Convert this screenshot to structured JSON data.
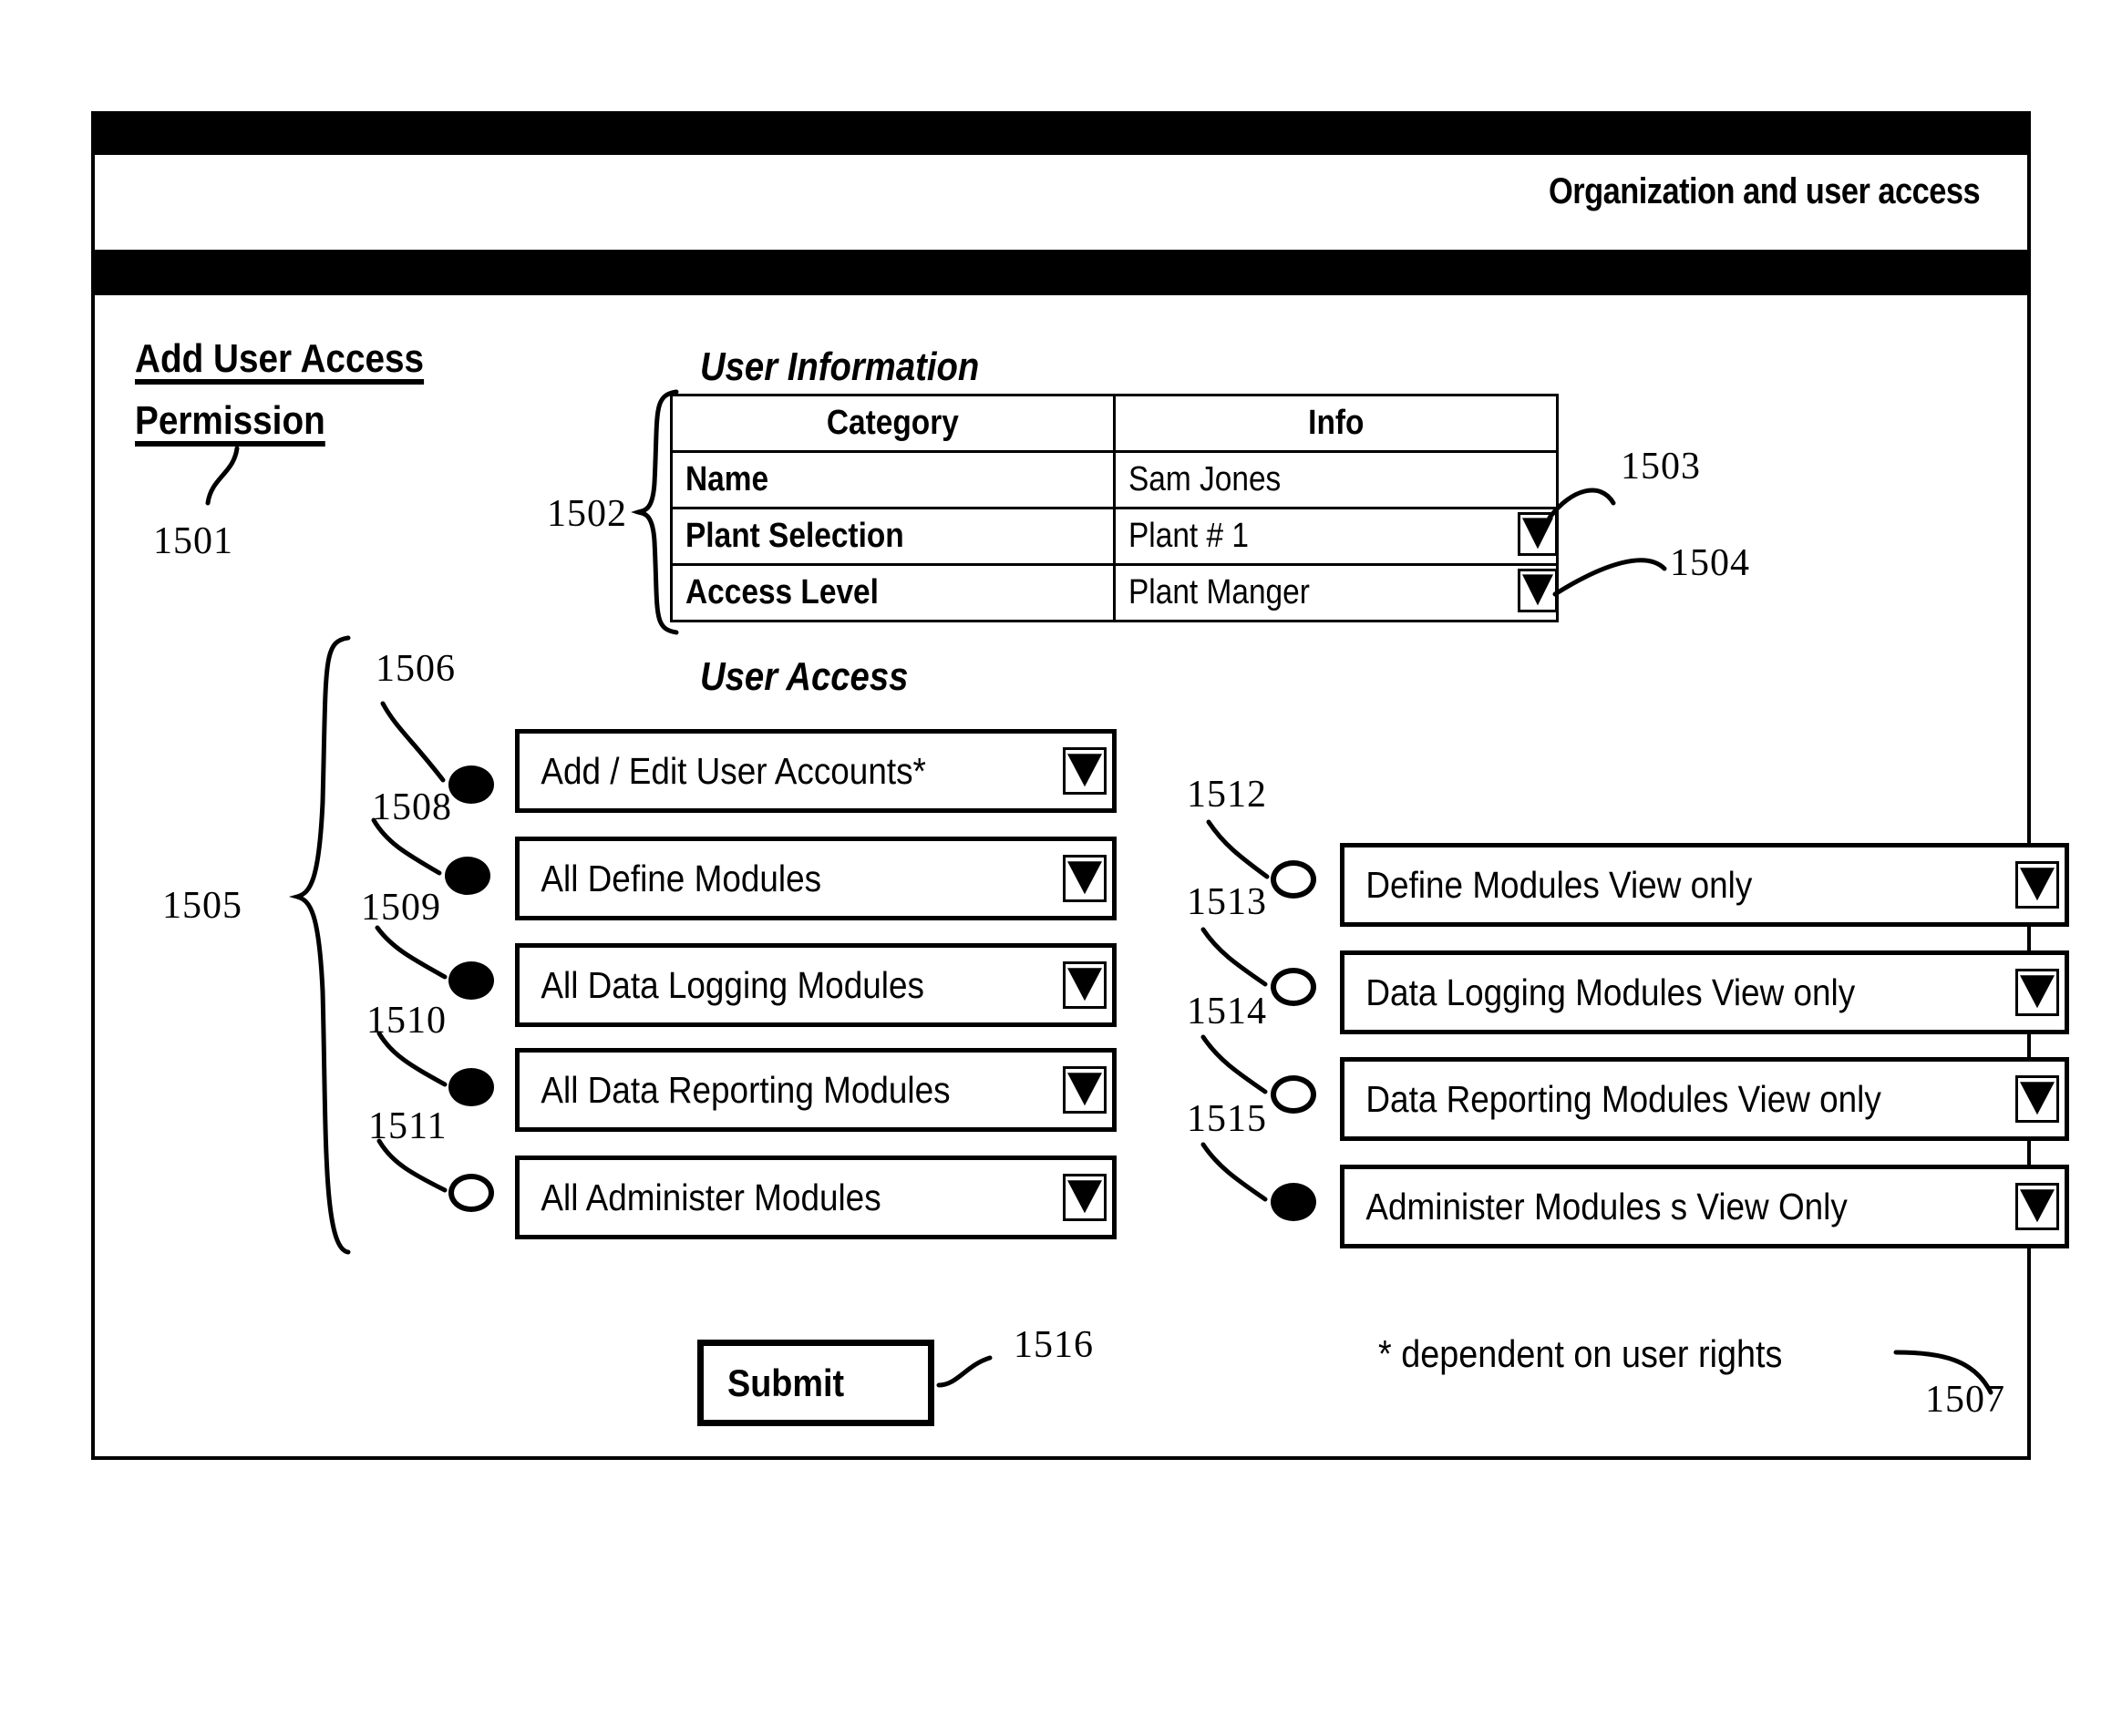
{
  "window": {
    "header_title": "Organization and user access"
  },
  "left_heading": {
    "line1": "Add User Access",
    "line2": "Permission",
    "ref": "1501"
  },
  "user_information": {
    "title": "User Information",
    "ref": "1502",
    "columns": [
      "Category",
      "Info"
    ],
    "rows": [
      {
        "category": "Name",
        "info": "Sam Jones",
        "has_dropdown": false,
        "ref": ""
      },
      {
        "category": "Plant Selection",
        "info": "Plant # 1",
        "has_dropdown": true,
        "ref": "1503"
      },
      {
        "category": "Access Level",
        "info": "Plant Manger",
        "has_dropdown": true,
        "ref": "1504"
      }
    ]
  },
  "user_access": {
    "title": "User Access",
    "group_ref": "1505",
    "group_top_ref": "1506",
    "left_options": [
      {
        "label": "Add / Edit User Accounts*",
        "selected": true,
        "ref": "1508"
      },
      {
        "label": "All Define Modules",
        "selected": true,
        "ref": "1509"
      },
      {
        "label": "All Data Logging Modules",
        "selected": true,
        "ref": "1510"
      },
      {
        "label": "All Data Reporting Modules",
        "selected": true,
        "ref": "1511"
      },
      {
        "label": "All Administer Modules",
        "selected": false,
        "ref": ""
      }
    ],
    "right_options": [
      {
        "label": "Define Modules View only",
        "selected": false,
        "ref": "1512"
      },
      {
        "label": "Data Logging Modules View only",
        "selected": false,
        "ref": "1513"
      },
      {
        "label": "Data Reporting Modules View only",
        "selected": false,
        "ref": "1514"
      },
      {
        "label": "Administer Modules s View Only",
        "selected": true,
        "ref": "1515"
      }
    ]
  },
  "submit": {
    "label": "Submit",
    "ref": "1516"
  },
  "footnote": {
    "text": "* dependent on user rights",
    "ref": "1507"
  }
}
